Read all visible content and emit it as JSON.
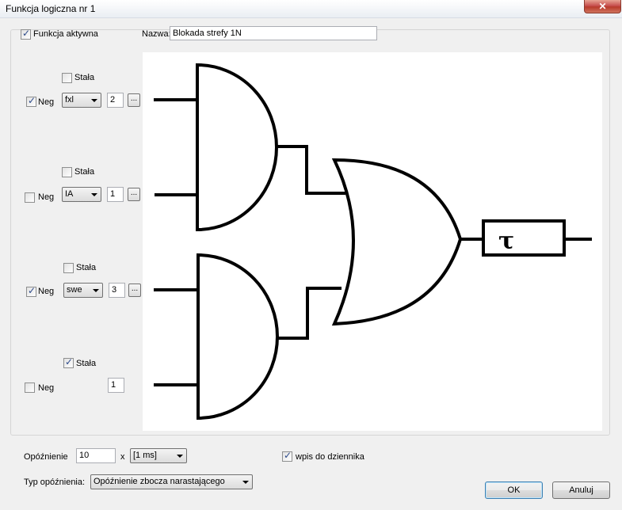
{
  "window": {
    "title": "Funkcja logiczna nr 1",
    "close_glyph": "✕"
  },
  "top": {
    "active_label": "Funkcja aktywna",
    "active_checked": true,
    "name_label": "Nazwa:",
    "name_value": "Blokada strefy 1N"
  },
  "inputs": [
    {
      "stala_label": "Stała",
      "stala_checked": false,
      "neg_label": "Neg",
      "neg_checked": true,
      "combo": "fxl",
      "value": "2",
      "browse": "..."
    },
    {
      "stala_label": "Stała",
      "stala_checked": false,
      "neg_label": "Neg",
      "neg_checked": false,
      "combo": "IA",
      "value": "1",
      "browse": "..."
    },
    {
      "stala_label": "Stała",
      "stala_checked": false,
      "neg_label": "Neg",
      "neg_checked": true,
      "combo": "swe",
      "value": "3",
      "browse": "..."
    },
    {
      "stala_label": "Stała",
      "stala_checked": true,
      "neg_label": "Neg",
      "neg_checked": false,
      "value": "1"
    }
  ],
  "diagram": {
    "timer_symbol": "τ"
  },
  "bottom": {
    "delay_label": "Opóźnienie",
    "delay_value": "10",
    "multiply": "x",
    "unit": "[1 ms]",
    "log_label": "wpis do dziennika",
    "log_checked": true,
    "delay_type_label": "Typ opóźnienia:",
    "delay_type": "Opóźnienie zbocza narastającego"
  },
  "buttons": {
    "ok": "OK",
    "cancel": "Anuluj"
  }
}
